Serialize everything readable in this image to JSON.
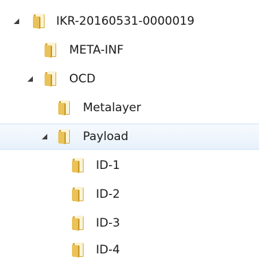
{
  "tree": {
    "nodes": [
      {
        "label": "IKR-20160531-0000019",
        "expanded": true,
        "depth": 0
      },
      {
        "label": "META-INF",
        "expanded": false,
        "depth": 1
      },
      {
        "label": "OCD",
        "expanded": true,
        "depth": 1
      },
      {
        "label": "Metalayer",
        "expanded": false,
        "depth": 2
      },
      {
        "label": "Payload",
        "expanded": true,
        "depth": 2,
        "selected": true
      },
      {
        "label": "ID-1",
        "expanded": false,
        "depth": 3
      },
      {
        "label": "ID-2",
        "expanded": false,
        "depth": 3
      },
      {
        "label": "ID-3",
        "expanded": false,
        "depth": 3
      },
      {
        "label": "ID-4",
        "expanded": false,
        "depth": 3
      }
    ]
  },
  "colors": {
    "folder_front": "#e9c35a",
    "folder_back": "#d9a93a",
    "folder_paper": "#fbf3d4",
    "expander": "#404040",
    "selection": "#e8f1fb"
  }
}
